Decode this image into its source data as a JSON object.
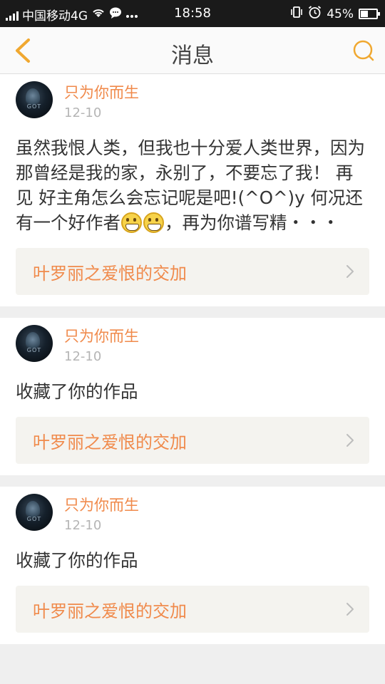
{
  "status_bar": {
    "carrier": "中国移动4G",
    "time": "18:58",
    "battery": "45%",
    "battery_level": 0.45
  },
  "header": {
    "title": "消息",
    "back_icon": "chevron-left-icon",
    "search_icon": "search-icon",
    "accent_color": "#f0a830"
  },
  "messages": [
    {
      "username": "只为你而生",
      "date": "12-10",
      "text_parts": [
        "虽然我恨人类，但我也十分爱人类世界，因为那曾经是我的家，永别了，不要忘了我！ 再见 好主角怎么会忘记呢是吧!(^O^)y 何况还有一个好作者",
        "，再为你谱写精・・・"
      ],
      "emojis": [
        "grinning-emoji",
        "grinning-emoji"
      ],
      "work_title": "叶罗丽之爱恨的交加"
    },
    {
      "username": "只为你而生",
      "date": "12-10",
      "text": "收藏了你的作品",
      "work_title": "叶罗丽之爱恨的交加"
    },
    {
      "username": "只为你而生",
      "date": "12-10",
      "text": "收藏了你的作品",
      "work_title": "叶罗丽之爱恨的交加"
    }
  ],
  "colors": {
    "username": "#f08a4b",
    "work_title": "#f08a4b",
    "date": "#b5b5b5",
    "link_bg": "#f4f3ef"
  }
}
